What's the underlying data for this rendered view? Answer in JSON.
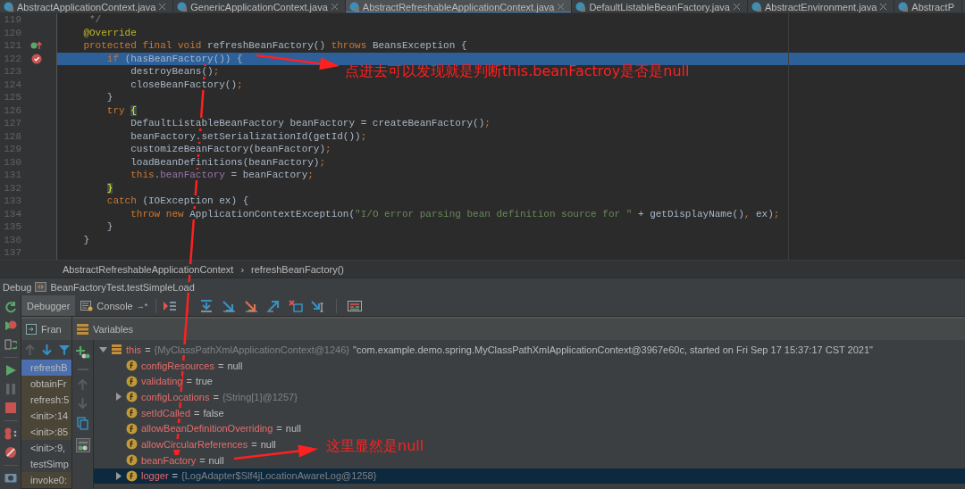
{
  "editor_tabs": [
    {
      "label": "AbstractApplicationContext.java",
      "selected": false,
      "closable": true
    },
    {
      "label": "GenericApplicationContext.java",
      "selected": false,
      "closable": true
    },
    {
      "label": "AbstractRefreshableApplicationContext.java",
      "selected": true,
      "closable": true
    },
    {
      "label": "DefaultListableBeanFactory.java",
      "selected": false,
      "closable": true
    },
    {
      "label": "AbstractEnvironment.java",
      "selected": false,
      "closable": true
    },
    {
      "label": "AbstractP",
      "selected": false,
      "closable": false
    }
  ],
  "code": [
    {
      "number": "119",
      "kind": "plain",
      "highlighted": false,
      "tokens": [
        {
          "text": "     */",
          "kind": "comment"
        }
      ]
    },
    {
      "number": "120",
      "kind": "plain",
      "highlighted": false,
      "tokens": [
        {
          "text": "    @Override",
          "kind": "annotation"
        }
      ]
    },
    {
      "number": "121",
      "kind": "override",
      "highlighted": false,
      "tokens": [
        {
          "text": "    protected final void ",
          "kind": "keyword"
        },
        {
          "text": "refreshBeanFactory() ",
          "kind": "plain"
        },
        {
          "text": "throws ",
          "kind": "keyword"
        },
        {
          "text": "BeansException {",
          "kind": "plain"
        }
      ]
    },
    {
      "number": "122",
      "kind": "breakpoint",
      "highlighted": true,
      "tokens": [
        {
          "text": "        if ",
          "kind": "keyword"
        },
        {
          "text": "(hasBeanFactory()) {",
          "kind": "plain"
        }
      ]
    },
    {
      "number": "123",
      "kind": "plain",
      "highlighted": false,
      "tokens": [
        {
          "text": "            destroyBeans()",
          "kind": "plain"
        },
        {
          "text": ";",
          "kind": "keyword"
        }
      ]
    },
    {
      "number": "124",
      "kind": "plain",
      "highlighted": false,
      "tokens": [
        {
          "text": "            closeBeanFactory()",
          "kind": "plain"
        },
        {
          "text": ";",
          "kind": "keyword"
        }
      ]
    },
    {
      "number": "125",
      "kind": "plain",
      "highlighted": false,
      "tokens": [
        {
          "text": "        }",
          "kind": "plain"
        }
      ]
    },
    {
      "number": "126",
      "kind": "plain",
      "highlighted": false,
      "tokens": [
        {
          "text": "        try ",
          "kind": "keyword"
        },
        {
          "text": "{",
          "kind": "brace"
        }
      ]
    },
    {
      "number": "127",
      "kind": "plain",
      "highlighted": false,
      "tokens": [
        {
          "text": "            DefaultListableBeanFactory beanFactory = createBeanFactory()",
          "kind": "plain"
        },
        {
          "text": ";",
          "kind": "keyword"
        }
      ]
    },
    {
      "number": "128",
      "kind": "plain",
      "highlighted": false,
      "tokens": [
        {
          "text": "            beanFactory.setSerializationId(getId())",
          "kind": "plain"
        },
        {
          "text": ";",
          "kind": "keyword"
        }
      ]
    },
    {
      "number": "129",
      "kind": "plain",
      "highlighted": false,
      "tokens": [
        {
          "text": "            customizeBeanFactory(beanFactory)",
          "kind": "plain"
        },
        {
          "text": ";",
          "kind": "keyword"
        }
      ]
    },
    {
      "number": "130",
      "kind": "plain",
      "highlighted": false,
      "tokens": [
        {
          "text": "            loadBeanDefinitions(beanFactory)",
          "kind": "plain"
        },
        {
          "text": ";",
          "kind": "keyword"
        }
      ]
    },
    {
      "number": "131",
      "kind": "plain",
      "highlighted": false,
      "tokens": [
        {
          "text": "            this",
          "kind": "keyword"
        },
        {
          "text": ".",
          "kind": "plain"
        },
        {
          "text": "beanFactory",
          "kind": "field"
        },
        {
          "text": " = beanFactory",
          "kind": "plain"
        },
        {
          "text": ";",
          "kind": "keyword"
        }
      ]
    },
    {
      "number": "132",
      "kind": "plain",
      "highlighted": false,
      "tokens": [
        {
          "text": "        }",
          "kind": "brace"
        }
      ]
    },
    {
      "number": "133",
      "kind": "plain",
      "highlighted": false,
      "tokens": [
        {
          "text": "        catch ",
          "kind": "keyword"
        },
        {
          "text": "(IOException ex) {",
          "kind": "plain"
        }
      ]
    },
    {
      "number": "134",
      "kind": "plain",
      "highlighted": false,
      "tokens": [
        {
          "text": "            throw new ",
          "kind": "keyword"
        },
        {
          "text": "ApplicationContextException(",
          "kind": "plain"
        },
        {
          "text": "\"I/O error parsing bean definition source for \"",
          "kind": "string"
        },
        {
          "text": " + getDisplayName()",
          "kind": "plain"
        },
        {
          "text": ",",
          "kind": "keyword"
        },
        {
          "text": " ex)",
          "kind": "plain"
        },
        {
          "text": ";",
          "kind": "keyword"
        }
      ]
    },
    {
      "number": "135",
      "kind": "plain",
      "highlighted": false,
      "tokens": [
        {
          "text": "        }",
          "kind": "plain"
        }
      ]
    },
    {
      "number": "136",
      "kind": "plain",
      "highlighted": false,
      "tokens": [
        {
          "text": "    }",
          "kind": "plain"
        }
      ]
    },
    {
      "number": "137",
      "kind": "plain",
      "highlighted": false
    }
  ],
  "breadcrumb": [
    "AbstractRefreshableApplicationContext",
    "›",
    "refreshBeanFactory()"
  ],
  "debug": {
    "title": "Debug",
    "config": "BeanFactoryTest.testSimpleLoad",
    "tabs": [
      {
        "label": "Debugger",
        "selected": true
      },
      {
        "label": "Console",
        "selected": false,
        "pin": "→*"
      }
    ],
    "frames_header": "Fran",
    "variables_header": "Variables",
    "frames": [
      {
        "label": "refreshB",
        "selected": true,
        "library": false
      },
      {
        "label": "obtainFr",
        "selected": false,
        "library": true
      },
      {
        "label": "refresh:5",
        "selected": false,
        "library": true
      },
      {
        "label": "<init>:14",
        "selected": false,
        "library": true
      },
      {
        "label": "<init>:85",
        "selected": false,
        "library": true
      },
      {
        "label": "<init>:9,",
        "selected": false,
        "library": false
      },
      {
        "label": "testSimp",
        "selected": false,
        "library": false
      },
      {
        "label": "invoke0:",
        "selected": false,
        "library": true
      }
    ],
    "variables": [
      {
        "name": "this",
        "kind": "object",
        "operator": "=",
        "expandable": true,
        "expanded": true,
        "selected": false,
        "ref": "{MyClassPathXmlApplicationContext@1246}",
        "value": "\"com.example.demo.spring.MyClassPathXmlApplicationContext@3967e60c, started on Fri Sep 17 15:37:17 CST 2021\"",
        "children": [
          {
            "name": "configResources",
            "kind": "field",
            "operator": "=",
            "expandable": false,
            "selected": false,
            "value": "null"
          },
          {
            "name": "validating",
            "kind": "field",
            "operator": "=",
            "expandable": false,
            "selected": false,
            "value": "true"
          },
          {
            "name": "configLocations",
            "kind": "field",
            "operator": "=",
            "expandable": true,
            "expanded": false,
            "selected": false,
            "ref": "{String[1]@1257}"
          },
          {
            "name": "setIdCalled",
            "kind": "field",
            "operator": "=",
            "expandable": false,
            "selected": false,
            "value": "false"
          },
          {
            "name": "allowBeanDefinitionOverriding",
            "kind": "field",
            "operator": "=",
            "expandable": false,
            "selected": false,
            "value": "null"
          },
          {
            "name": "allowCircularReferences",
            "kind": "field",
            "operator": "=",
            "expandable": false,
            "selected": false,
            "value": "null"
          },
          {
            "name": "beanFactory",
            "kind": "field",
            "operator": "=",
            "expandable": false,
            "selected": false,
            "value": "null"
          },
          {
            "name": "logger",
            "kind": "field",
            "operator": "=",
            "expandable": true,
            "expanded": false,
            "selected": true,
            "ref": "{LogAdapter$Slf4jLocationAwareLog@1258}"
          }
        ]
      }
    ]
  },
  "annotations": [
    {
      "text": "点进去可以发现就是判断this.beanFactroy是否是null"
    },
    {
      "text": "这里显然是null"
    }
  ]
}
